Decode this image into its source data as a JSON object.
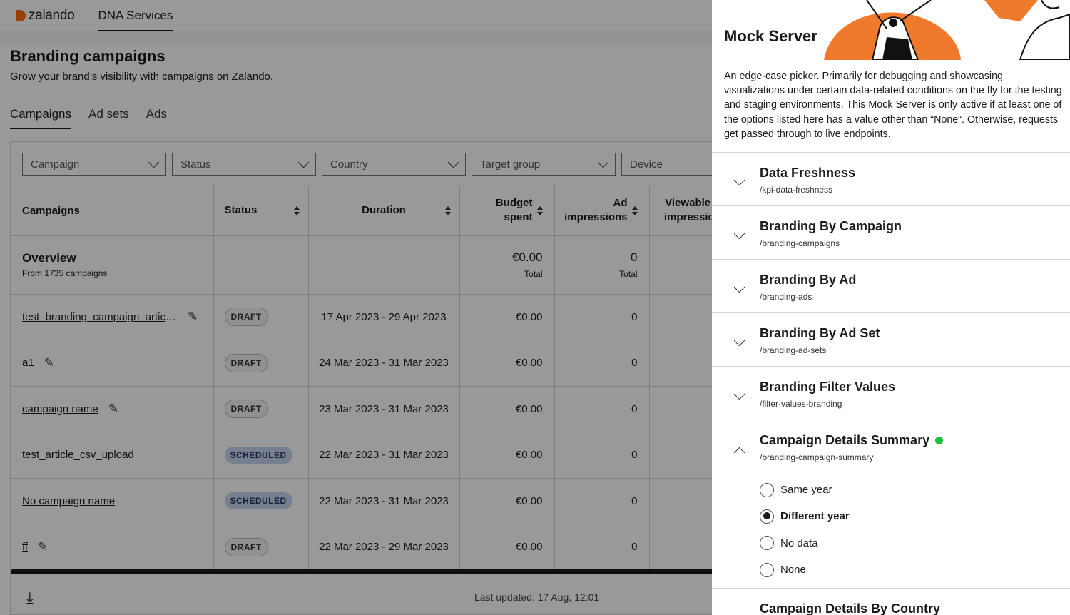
{
  "brand": {
    "logo_text": "zalando",
    "accent": "#ff6900"
  },
  "nav": {
    "active_item": "DNA Services"
  },
  "page": {
    "title": "Branding campaigns",
    "subtitle": "Grow your brand’s visibility with campaigns on Zalando."
  },
  "tabs": [
    {
      "label": "Campaigns",
      "active": true
    },
    {
      "label": "Ad sets",
      "active": false
    },
    {
      "label": "Ads",
      "active": false
    }
  ],
  "filters": [
    {
      "placeholder": "Campaign"
    },
    {
      "placeholder": "Status"
    },
    {
      "placeholder": "Country"
    },
    {
      "placeholder": "Target group"
    },
    {
      "placeholder": "Device"
    }
  ],
  "table": {
    "headers": {
      "campaigns": "Campaigns",
      "status": "Status",
      "duration": "Duration",
      "budget_line1": "Budget",
      "budget_line2": "spent",
      "imp_line1": "Ad",
      "imp_line2": "impressions",
      "view_line1": "Viewable ad",
      "view_line2": "impressions"
    },
    "overview": {
      "title": "Overview",
      "subtitle": "From 1735 campaigns",
      "budget": "€0.00",
      "budget_label": "Total",
      "impressions": "0",
      "impressions_label": "Total"
    },
    "rows": [
      {
        "name": "test_branding_campaign_article_csv",
        "status": "DRAFT",
        "duration": "17 Apr 2023 - 29 Apr 2023",
        "budget": "€0.00",
        "impressions": "0"
      },
      {
        "name": "a1",
        "status": "DRAFT",
        "duration": "24 Mar 2023 - 31 Mar 2023",
        "budget": "€0.00",
        "impressions": "0"
      },
      {
        "name": "campaign name",
        "status": "DRAFT",
        "duration": "23 Mar 2023 - 31 Mar 2023",
        "budget": "€0.00",
        "impressions": "0"
      },
      {
        "name": "test_article_csv_upload",
        "status": "SCHEDULED",
        "duration": "22 Mar 2023 - 31 Mar 2023",
        "budget": "€0.00",
        "impressions": "0"
      },
      {
        "name": "No campaign name",
        "status": "SCHEDULED",
        "duration": "22 Mar 2023 - 31 Mar 2023",
        "budget": "€0.00",
        "impressions": "0"
      },
      {
        "name": "ff",
        "status": "DRAFT",
        "duration": "22 Mar 2023 - 29 Mar 2023",
        "budget": "€0.00",
        "impressions": "0"
      }
    ]
  },
  "footer": {
    "last_updated": "Last updated: 17 Aug, 12:01"
  },
  "drawer": {
    "title": "Mock Server",
    "description": "An edge-case picker. Primarily for debugging and showcasing visualizations under certain data-related conditions on the fly for the testing and staging environments. This Mock Server is only active if at least one of the options listed here has a value other than “None“. Otherwise, requests get passed through to live endpoints.",
    "items": [
      {
        "name": "Data Freshness",
        "path": "/kpi-data-freshness"
      },
      {
        "name": "Branding By Campaign",
        "path": "/branding-campaigns"
      },
      {
        "name": "Branding By Ad",
        "path": "/branding-ads"
      },
      {
        "name": "Branding By Ad Set",
        "path": "/branding-ad-sets"
      },
      {
        "name": "Branding Filter Values",
        "path": "/filter-values-branding"
      }
    ],
    "open_item": {
      "name": "Campaign Details Summary",
      "path": "/branding-campaign-summary",
      "active_color": "#1fbf3c",
      "options": [
        "Same year",
        "Different year",
        "No data",
        "None"
      ],
      "selected": "Different year"
    },
    "next_item": {
      "name": "Campaign Details By Country"
    }
  }
}
